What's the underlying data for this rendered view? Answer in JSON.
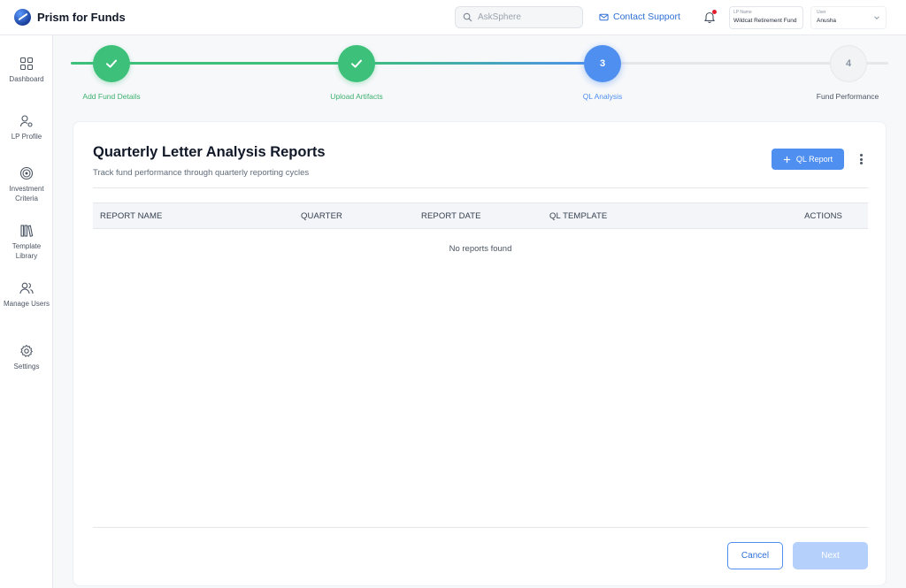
{
  "app": {
    "name": "Prism for Funds"
  },
  "header": {
    "search_placeholder": "AskSphere",
    "contact_support": "Contact Support",
    "lp_name_label": "LP Name",
    "lp_name_value": "Wildcat Retirement Fund",
    "user_label": "User",
    "user_value": "Anusha"
  },
  "sidebar": {
    "items": [
      {
        "label": "Dashboard",
        "icon": "grid-icon"
      },
      {
        "label": "LP Profile",
        "icon": "user-settings-icon"
      },
      {
        "label": "Investment Criteria",
        "icon": "target-icon"
      },
      {
        "label": "Template Library",
        "icon": "library-icon"
      },
      {
        "label": "Manage Users",
        "icon": "users-icon"
      },
      {
        "label": "Settings",
        "icon": "gear-icon"
      }
    ]
  },
  "stepper": {
    "steps": [
      {
        "label": "Add Fund Details",
        "state": "done"
      },
      {
        "label": "Upload Artifacts",
        "state": "done"
      },
      {
        "label": "QL Analysis",
        "state": "active",
        "number": "3"
      },
      {
        "label": "Fund Performance",
        "state": "pending",
        "number": "4"
      }
    ]
  },
  "card": {
    "title": "Quarterly Letter Analysis Reports",
    "subtitle": "Track fund performance through quarterly reporting cycles",
    "add_button": "QL Report",
    "columns": [
      "REPORT NAME",
      "QUARTER",
      "REPORT DATE",
      "QL TEMPLATE",
      "ACTIONS"
    ],
    "empty_message": "No reports found"
  },
  "footer": {
    "cancel": "Cancel",
    "next": "Next"
  },
  "colors": {
    "primary": "#4f8ff0",
    "success": "#3cc07a",
    "notification_dot": "#e11d2e",
    "disabled_button": "#b5d0fa"
  }
}
